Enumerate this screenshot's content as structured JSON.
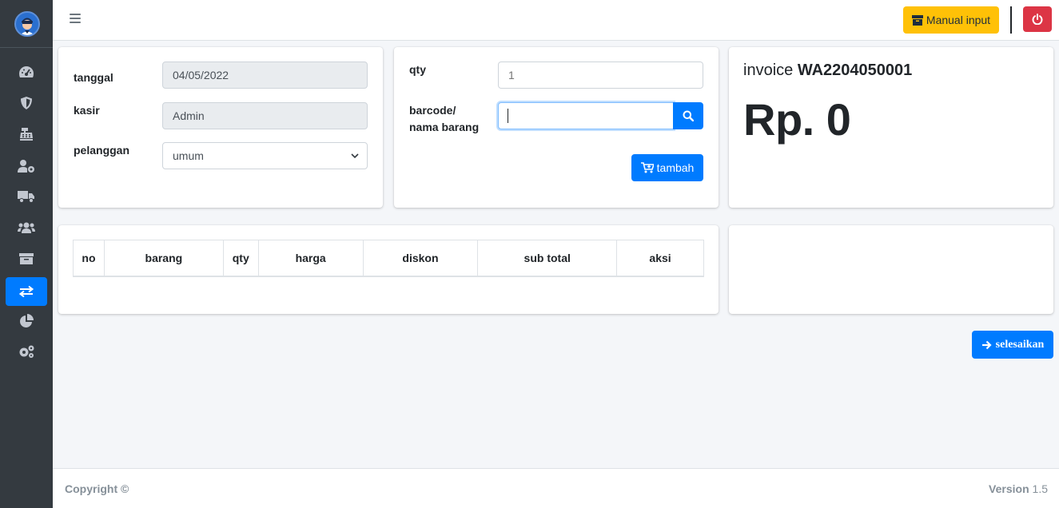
{
  "sidebar": {
    "items": [
      {
        "icon": "dashboard-icon"
      },
      {
        "icon": "shield-icon"
      },
      {
        "icon": "cash-register-icon"
      },
      {
        "icon": "user-cog-icon"
      },
      {
        "icon": "truck-icon"
      },
      {
        "icon": "users-icon"
      },
      {
        "icon": "archive-icon"
      },
      {
        "icon": "exchange-icon",
        "active": true
      },
      {
        "icon": "pie-chart-icon"
      },
      {
        "icon": "cogs-icon"
      }
    ]
  },
  "navbar": {
    "manual_input_label": "Manual input"
  },
  "form": {
    "tanggal_label": "tanggal",
    "tanggal_value": "04/05/2022",
    "kasir_label": "kasir",
    "kasir_value": "Admin",
    "pelanggan_label": "pelanggan",
    "pelanggan_value": "umum"
  },
  "item_entry": {
    "qty_label": "qty",
    "qty_placeholder": "1",
    "barcode_label_line1": "barcode/",
    "barcode_label_line2": "nama barang",
    "barcode_value": "",
    "tambah_label": "tambah"
  },
  "invoice": {
    "prefix": "invoice",
    "number": "WA2204050001",
    "total": "Rp. 0"
  },
  "table": {
    "columns": [
      "no",
      "barang",
      "qty",
      "harga",
      "diskon",
      "sub total",
      "aksi"
    ],
    "rows": []
  },
  "actions": {
    "finish_label": "selesaikan"
  },
  "footer": {
    "copyright": "Copyright ©",
    "version_label": "Version",
    "version_number": "1.5"
  },
  "colors": {
    "primary": "#007bff",
    "warning": "#ffc107",
    "danger": "#dc3545",
    "sidebar": "#343a40"
  }
}
